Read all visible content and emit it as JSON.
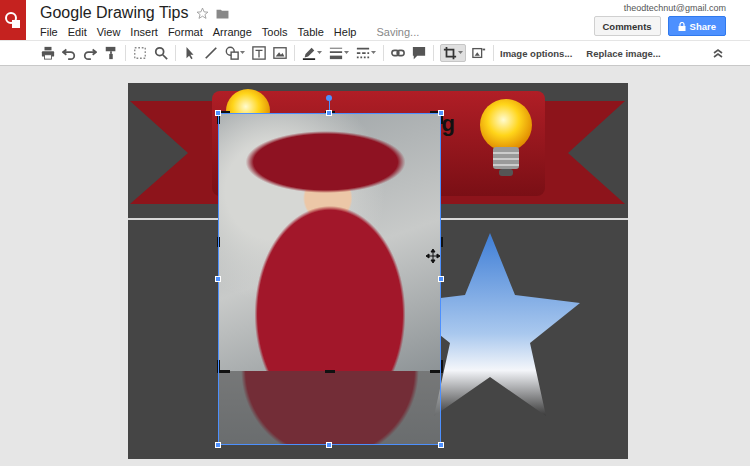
{
  "window": {
    "title": "Google Drawing Tips",
    "status": "Saving...",
    "account": "theodtechnut@gmail.com"
  },
  "menu": [
    "File",
    "Edit",
    "View",
    "Insert",
    "Format",
    "Arrange",
    "Tools",
    "Table",
    "Help"
  ],
  "header_buttons": [
    {
      "label": "Comments",
      "primary": false
    },
    {
      "label": "Share",
      "primary": true
    }
  ],
  "toolbar": {
    "buttons": [
      "Image options...",
      "Replace image..."
    ]
  },
  "canvas": {
    "banner_text": "ng",
    "selected_image": {
      "selected": true,
      "cropping": true
    }
  }
}
